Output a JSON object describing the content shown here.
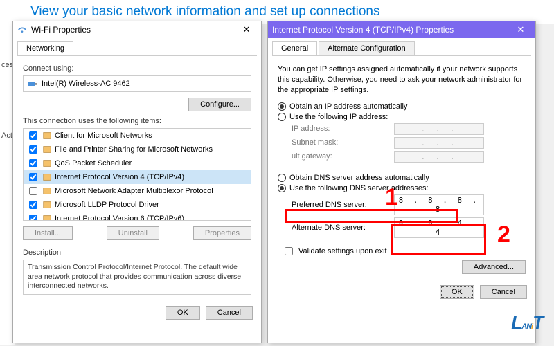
{
  "header": "View your basic network information and set up connections",
  "left_strip": {
    "a": "ces",
    "b": "Act"
  },
  "wifi": {
    "title": "Wi-Fi Properties",
    "tab": "Networking",
    "connect_label": "Connect using:",
    "adapter": "Intel(R) Wireless-AC 9462",
    "configure": "Configure...",
    "items_label": "This connection uses the following items:",
    "items": [
      {
        "c": true,
        "t": "Client for Microsoft Networks"
      },
      {
        "c": true,
        "t": "File and Printer Sharing for Microsoft Networks"
      },
      {
        "c": true,
        "t": "QoS Packet Scheduler"
      },
      {
        "c": true,
        "t": "Internet Protocol Version 4 (TCP/IPv4)",
        "sel": true
      },
      {
        "c": false,
        "t": "Microsoft Network Adapter Multiplexor Protocol"
      },
      {
        "c": true,
        "t": "Microsoft LLDP Protocol Driver"
      },
      {
        "c": true,
        "t": "Internet Protocol Version 6 (TCP/IPv6)"
      }
    ],
    "install": "Install...",
    "uninstall": "Uninstall",
    "properties": "Properties",
    "desc_title": "Description",
    "desc": "Transmission Control Protocol/Internet Protocol. The default wide area network protocol that provides communication across diverse interconnected networks.",
    "ok": "OK",
    "cancel": "Cancel"
  },
  "ipv4": {
    "title": "Internet Protocol Version 4 (TCP/IPv4) Properties",
    "tab_general": "General",
    "tab_alt": "Alternate Configuration",
    "intro": "You can get IP settings assigned automatically if your network supports this capability. Otherwise, you need to ask your network administrator for the appropriate IP settings.",
    "ip_auto": "Obtain an IP address automatically",
    "ip_manual": "Use the following IP address:",
    "ip_addr": "IP address:",
    "subnet": "Subnet mask:",
    "gateway": "ult gateway:",
    "dns_auto": "Obtain DNS server address automatically",
    "dns_manual": "Use the following DNS server addresses:",
    "pref_dns": "Preferred DNS server:",
    "alt_dns": "Alternate DNS server:",
    "pref_val": "8 . 8 . 8 . 8",
    "alt_val": "8 . 8 . 4 . 4",
    "dot_placeholder": ".   .   .",
    "validate": "Validate settings upon exit",
    "advanced": "Advanced...",
    "ok": "OK",
    "cancel": "Cancel"
  },
  "anno": {
    "one": "1",
    "two": "2"
  },
  "watermark": "LANiT"
}
